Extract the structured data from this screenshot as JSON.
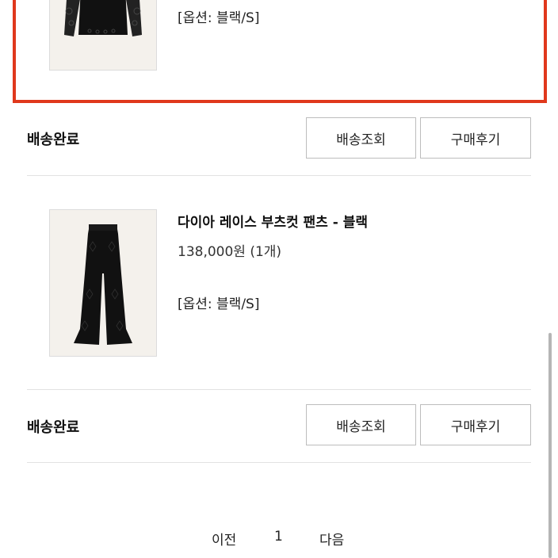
{
  "order1": {
    "option": "[옵션: 블랙/S]",
    "thumb_icon": "black-lace-top-image"
  },
  "delivery1": {
    "status": "배송완료",
    "track_label": "배송조회",
    "review_label": "구매후기"
  },
  "order2": {
    "title": "다이아 레이스 부츠컷 팬츠 - 블랙",
    "price": "138,000원 (1개)",
    "option": "[옵션: 블랙/S]",
    "thumb_icon": "black-bootcut-pants-image"
  },
  "delivery2": {
    "status": "배송완료",
    "track_label": "배송조회",
    "review_label": "구매후기"
  },
  "pagination": {
    "prev": "이전",
    "current": "1",
    "next": "다음"
  },
  "colors": {
    "highlight": "#e0381c"
  }
}
